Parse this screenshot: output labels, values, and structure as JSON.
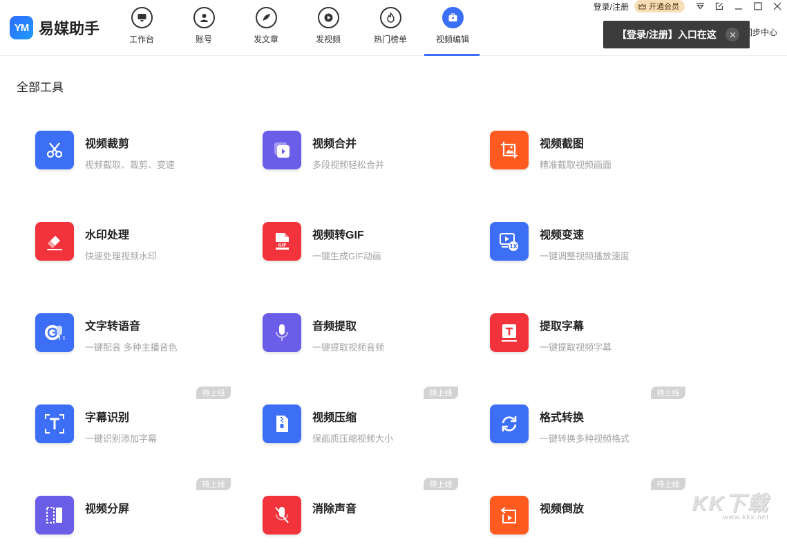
{
  "app": {
    "logo_mark": "YM",
    "name": "易媒助手"
  },
  "nav": [
    {
      "label": "工作台",
      "icon": "monitor-icon"
    },
    {
      "label": "账号",
      "icon": "user-icon"
    },
    {
      "label": "发文章",
      "icon": "feather-icon"
    },
    {
      "label": "发视频",
      "icon": "play-icon"
    },
    {
      "label": "热门榜单",
      "icon": "flame-icon"
    },
    {
      "label": "视频编辑",
      "icon": "toolbox-icon",
      "active": true
    }
  ],
  "window": {
    "login_label": "登录/注册",
    "vip_label": "开通会员",
    "sync_label": "同步中心"
  },
  "tooltip": {
    "text": "【登录/注册】入口在这"
  },
  "section_title": "全部工具",
  "badge_label": "待上线",
  "tools": [
    {
      "name": "视频裁剪",
      "desc": "视频截取、裁剪、变速",
      "icon": "scissors-icon",
      "color": "#3d6ff6"
    },
    {
      "name": "视频合并",
      "desc": "多段视频轻松合并",
      "icon": "layers-play-icon",
      "color": "#6a5de8"
    },
    {
      "name": "视频截图",
      "desc": "精准截取视频画面",
      "icon": "crop-image-icon",
      "color": "#ff5a1f"
    },
    {
      "name": "水印处理",
      "desc": "快速处理视频水印",
      "icon": "eraser-icon",
      "color": "#f2333b"
    },
    {
      "name": "视频转GIF",
      "desc": "一键生成GIF动画",
      "icon": "gif-file-icon",
      "color": "#f2333b"
    },
    {
      "name": "视频变速",
      "desc": "一键调整视频播放速度",
      "icon": "speed-icon",
      "color": "#3d6ff6"
    },
    {
      "name": "文字转语音",
      "desc": "一键配音 多种主播音色",
      "icon": "tts-icon",
      "color": "#3d6ff6"
    },
    {
      "name": "音频提取",
      "desc": "一键提取视频音频",
      "icon": "microphone-icon",
      "color": "#6a5de8"
    },
    {
      "name": "提取字幕",
      "desc": "一键提取视频字幕",
      "icon": "subtitle-icon",
      "color": "#f2333b"
    },
    {
      "name": "字幕识别",
      "desc": "一键识别添加字幕",
      "icon": "text-scan-icon",
      "color": "#3d6ff6",
      "pending": true
    },
    {
      "name": "视频压缩",
      "desc": "保画质压缩视频大小",
      "icon": "zip-icon",
      "color": "#3d6ff6",
      "pending": true
    },
    {
      "name": "格式转换",
      "desc": "一键转换多种视频格式",
      "icon": "convert-icon",
      "color": "#3d6ff6",
      "pending": true
    },
    {
      "name": "视频分屏",
      "desc": "",
      "icon": "split-screen-icon",
      "color": "#6a5de8",
      "pending": true
    },
    {
      "name": "消除声音",
      "desc": "",
      "icon": "mute-mic-icon",
      "color": "#f2333b",
      "pending": true
    },
    {
      "name": "视频倒放",
      "desc": "",
      "icon": "reverse-icon",
      "color": "#ff5a1f",
      "pending": true
    }
  ],
  "watermark": {
    "big": "KK下载",
    "small": "www.kkx.net"
  }
}
